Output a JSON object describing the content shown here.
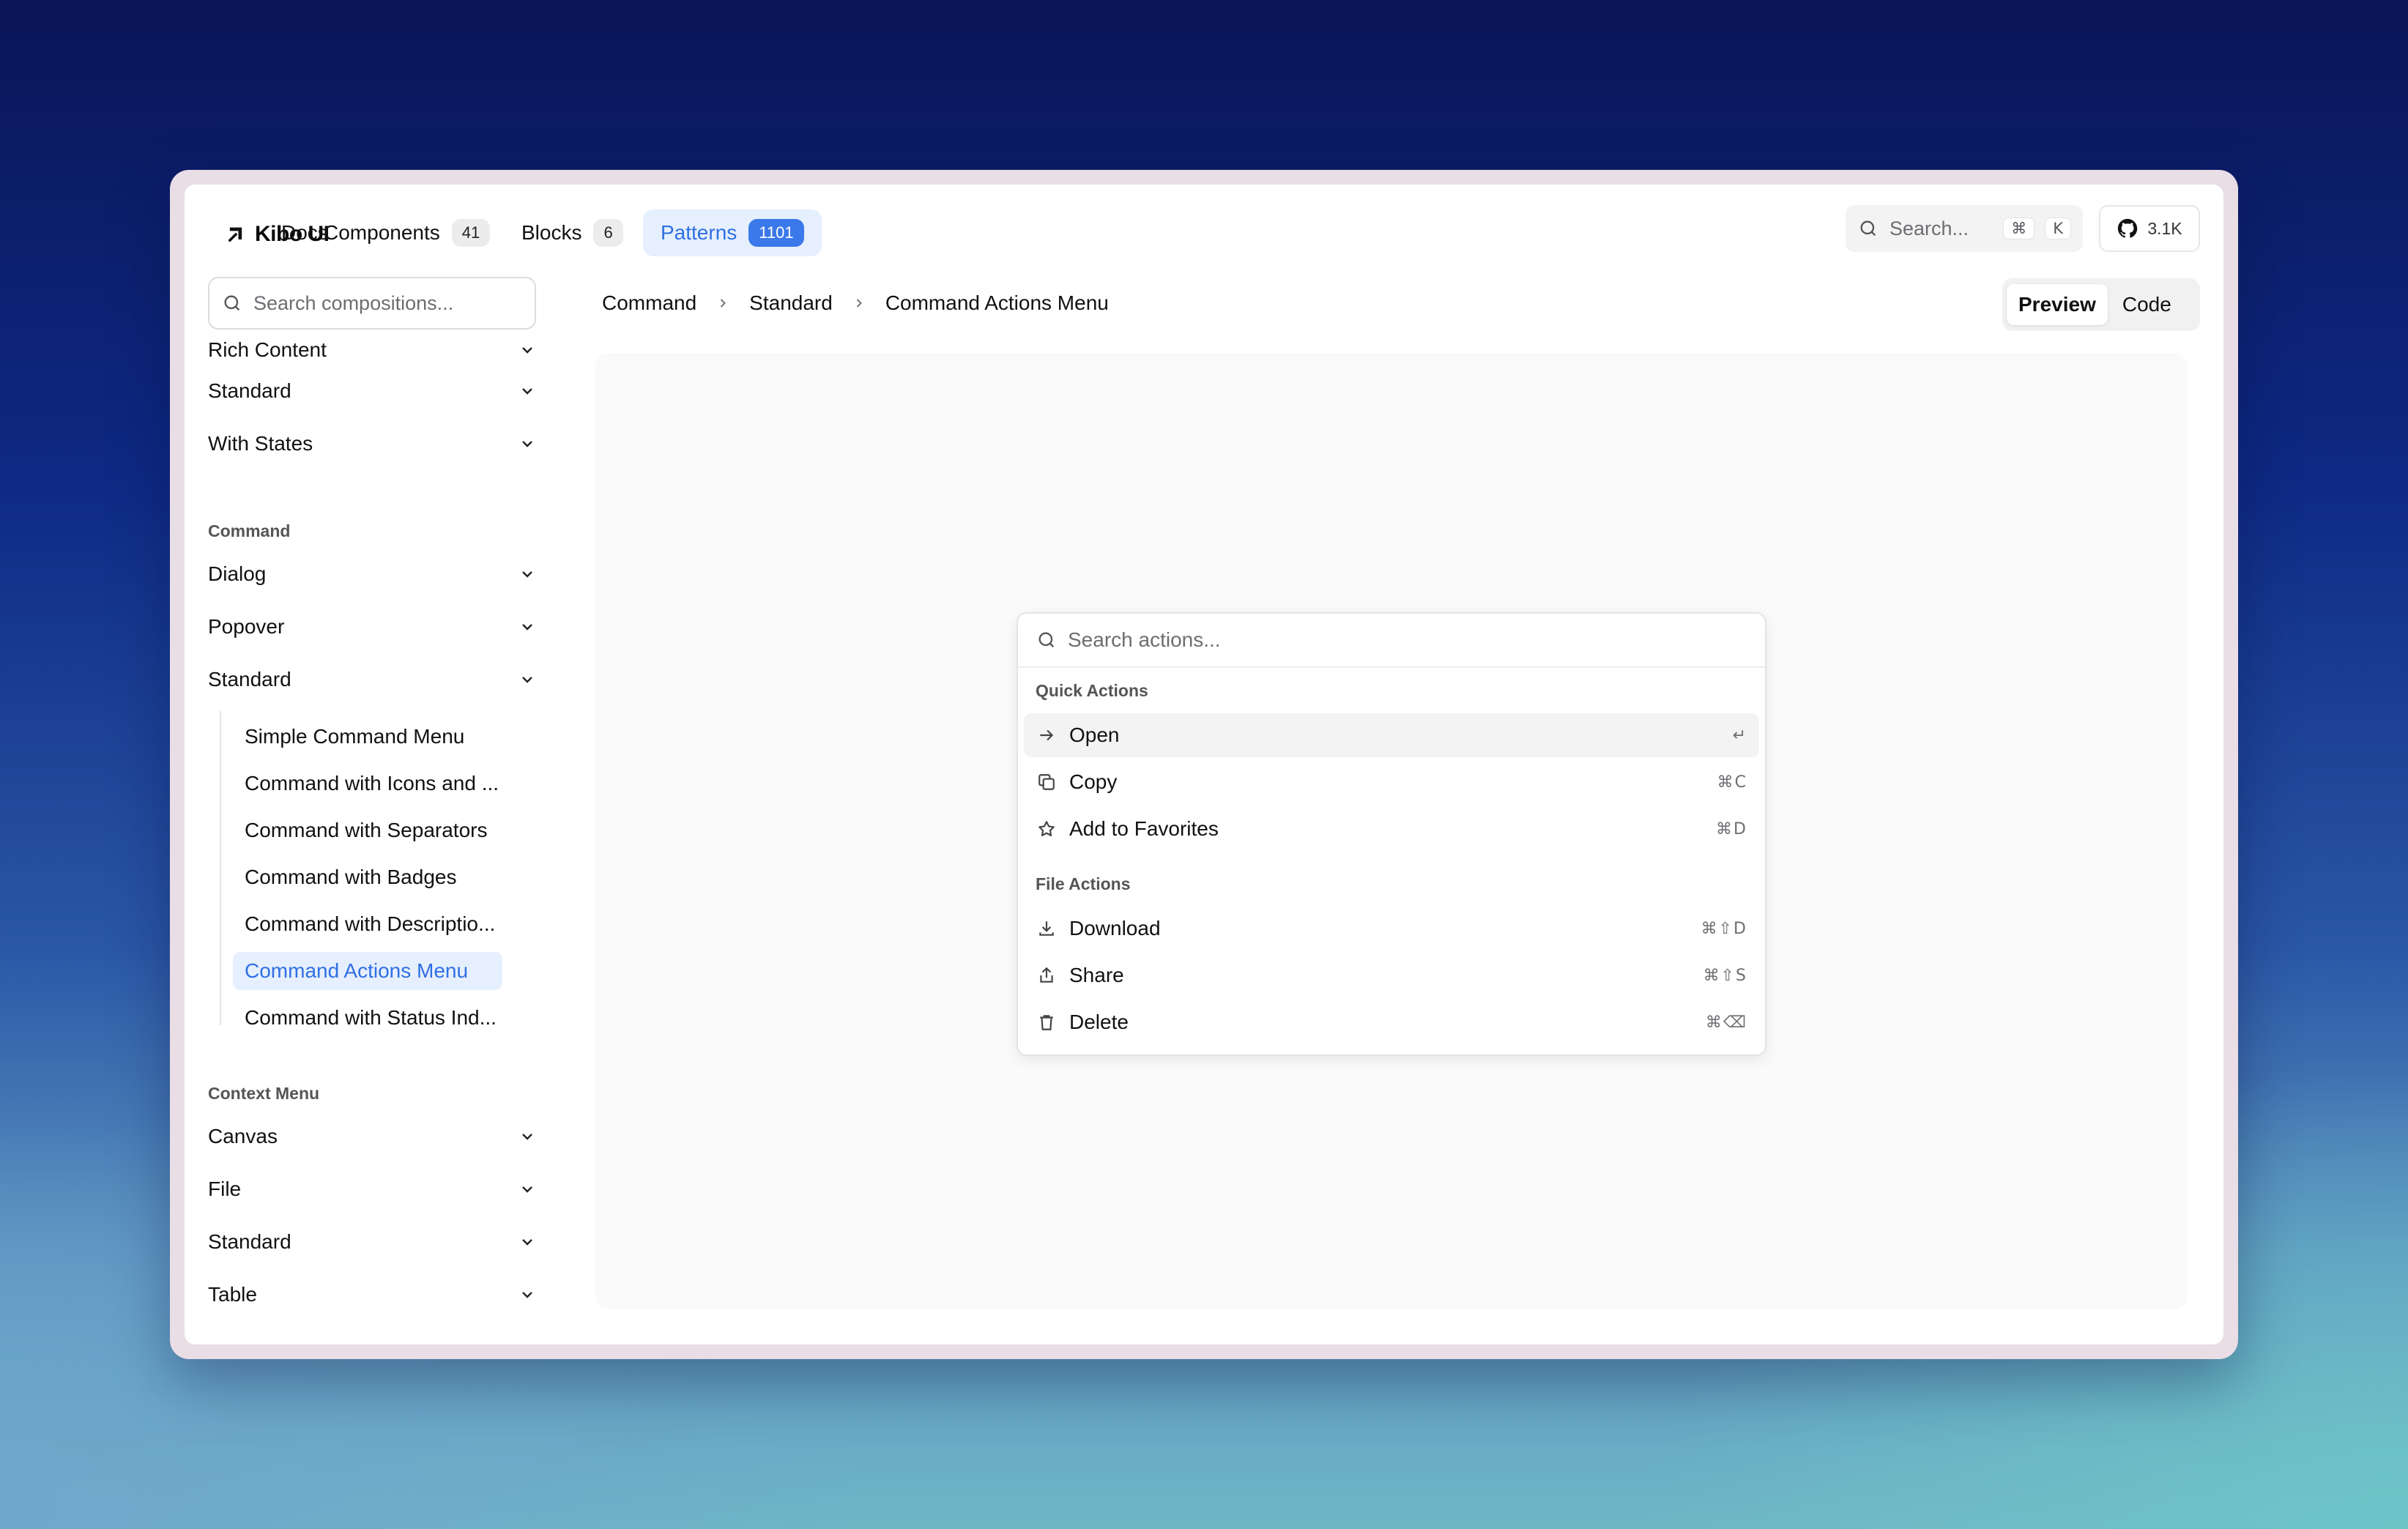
{
  "brand": {
    "name": "Kibo UI"
  },
  "nav": {
    "items": [
      {
        "label": "Docs",
        "badge": ""
      },
      {
        "label": "Components",
        "badge": "41"
      },
      {
        "label": "Blocks",
        "badge": "6"
      },
      {
        "label": "Patterns",
        "badge": "1101",
        "active": true
      }
    ],
    "search": {
      "placeholder": "Search...",
      "key1": "⌘",
      "key2": "K"
    },
    "github": {
      "stars": "3.1K"
    }
  },
  "sidebar": {
    "search_placeholder": "Search compositions...",
    "groups_top": [
      "Rich Content",
      "Standard",
      "With States"
    ],
    "section_command": "Command",
    "groups_command": [
      "Dialog",
      "Popover",
      "Standard"
    ],
    "sub_items": [
      "Simple Command Menu",
      "Command with Icons and ...",
      "Command with Separators",
      "Command with Badges",
      "Command with Descriptio...",
      "Command Actions Menu",
      "Command with Status Ind..."
    ],
    "section_context": "Context Menu",
    "groups_context": [
      "Canvas",
      "File",
      "Standard",
      "Table"
    ]
  },
  "breadcrumb": [
    "Command",
    "Standard",
    "Command Actions Menu"
  ],
  "view_toggle": {
    "preview": "Preview",
    "code": "Code"
  },
  "command_menu": {
    "placeholder": "Search actions...",
    "quick_heading": "Quick Actions",
    "quick_items": [
      {
        "label": "Open",
        "shortcut": "↵",
        "icon": "arrow-right-icon"
      },
      {
        "label": "Copy",
        "shortcut": "⌘C",
        "icon": "copy-icon"
      },
      {
        "label": "Add to Favorites",
        "shortcut": "⌘D",
        "icon": "star-icon"
      }
    ],
    "file_heading": "File Actions",
    "file_items": [
      {
        "label": "Download",
        "shortcut": "⌘⇧D",
        "icon": "download-icon"
      },
      {
        "label": "Share",
        "shortcut": "⌘⇧S",
        "icon": "share-icon"
      },
      {
        "label": "Delete",
        "shortcut": "⌘⌫",
        "icon": "trash-icon"
      }
    ]
  },
  "colors": {
    "accent": "#2f6fe4",
    "accent_bg": "#e6effd",
    "badge_active": "#3b79ea"
  }
}
